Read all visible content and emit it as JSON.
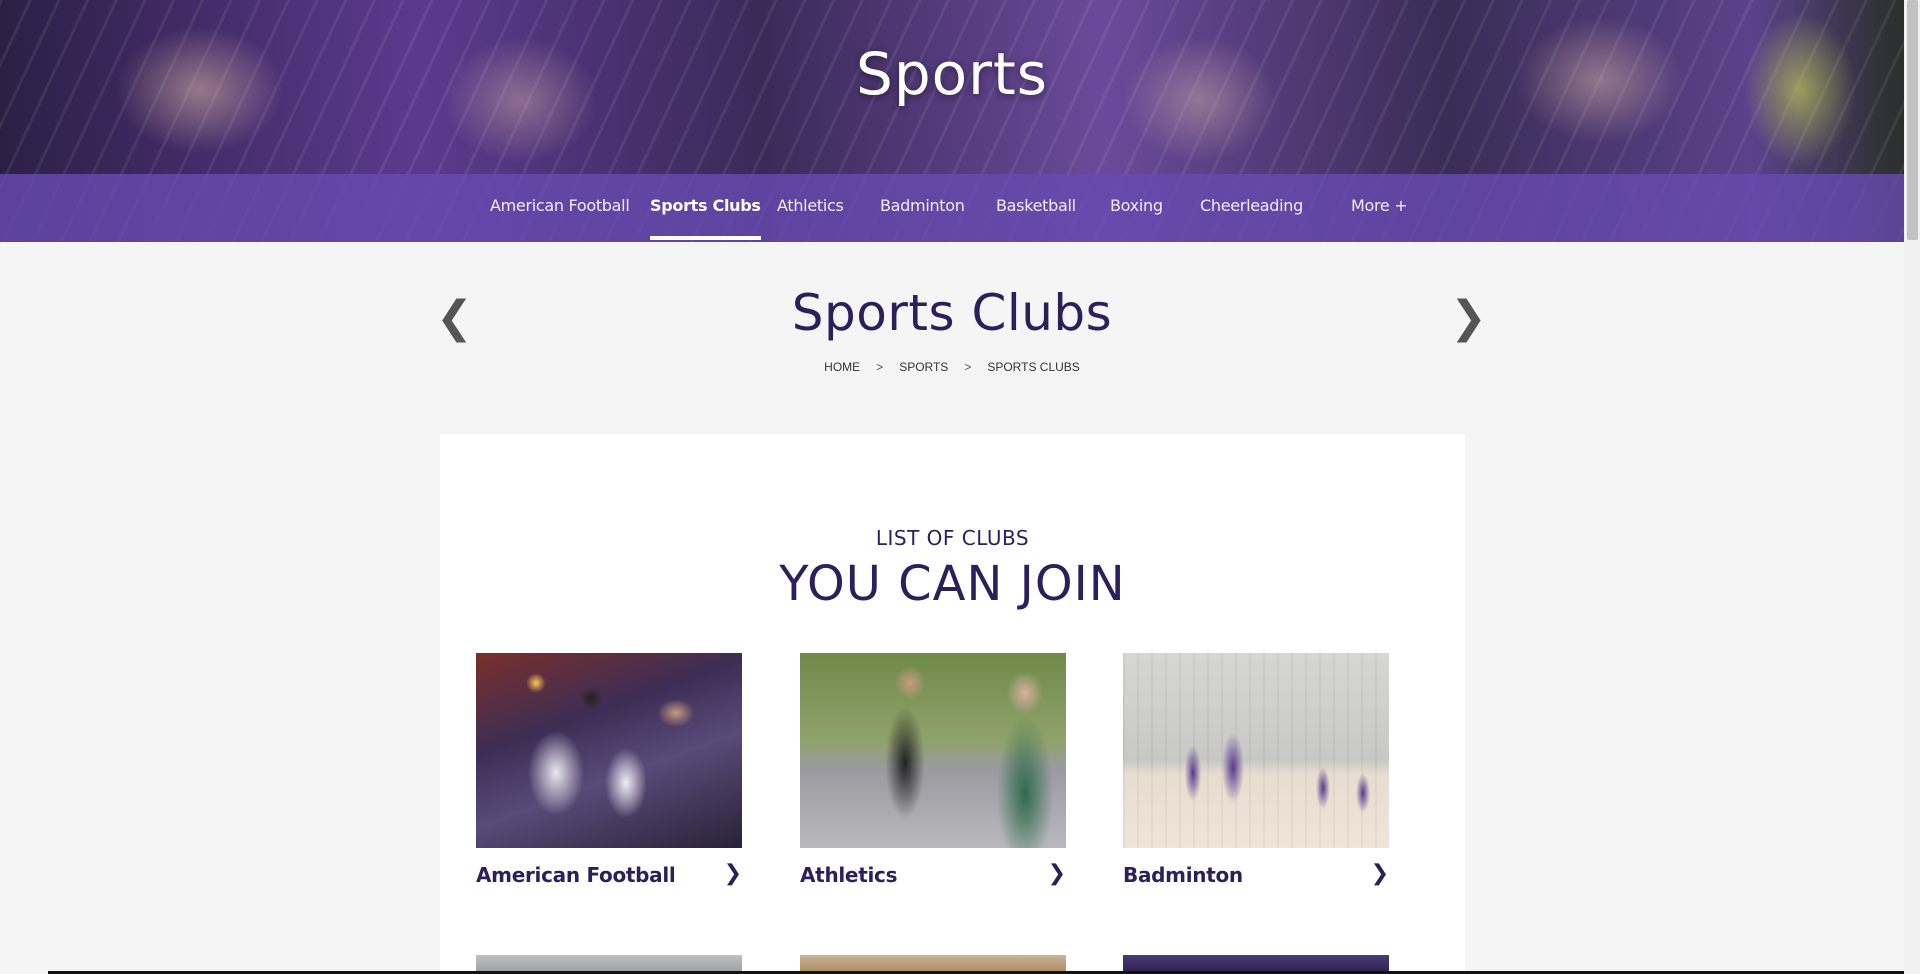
{
  "hero": {
    "title": "Sports"
  },
  "nav": {
    "items": [
      {
        "label": "American Football",
        "active": false
      },
      {
        "label": "Sports Clubs",
        "active": true
      },
      {
        "label": "Athletics",
        "active": false
      },
      {
        "label": "Badminton",
        "active": false
      },
      {
        "label": "Basketball",
        "active": false
      },
      {
        "label": "Boxing",
        "active": false
      },
      {
        "label": "Cheerleading",
        "active": false
      }
    ],
    "more_label": "More +"
  },
  "page": {
    "title": "Sports Clubs",
    "prev_icon": "❮",
    "next_icon": "❯"
  },
  "breadcrumb": {
    "items": [
      "HOME",
      "SPORTS",
      "SPORTS CLUBS"
    ],
    "separator": ">"
  },
  "clubs_section": {
    "kicker": "LIST OF CLUBS",
    "headline": "YOU CAN JOIN",
    "clubs": [
      {
        "name": "American Football",
        "arrow": "❯"
      },
      {
        "name": "Athletics",
        "arrow": "❯"
      },
      {
        "name": "Badminton",
        "arrow": "❯"
      }
    ]
  },
  "colors": {
    "brand_purple": "#674ab0",
    "heading_navy": "#2b1f5c",
    "page_bg": "#f5f5f5",
    "panel_bg": "#ffffff"
  }
}
